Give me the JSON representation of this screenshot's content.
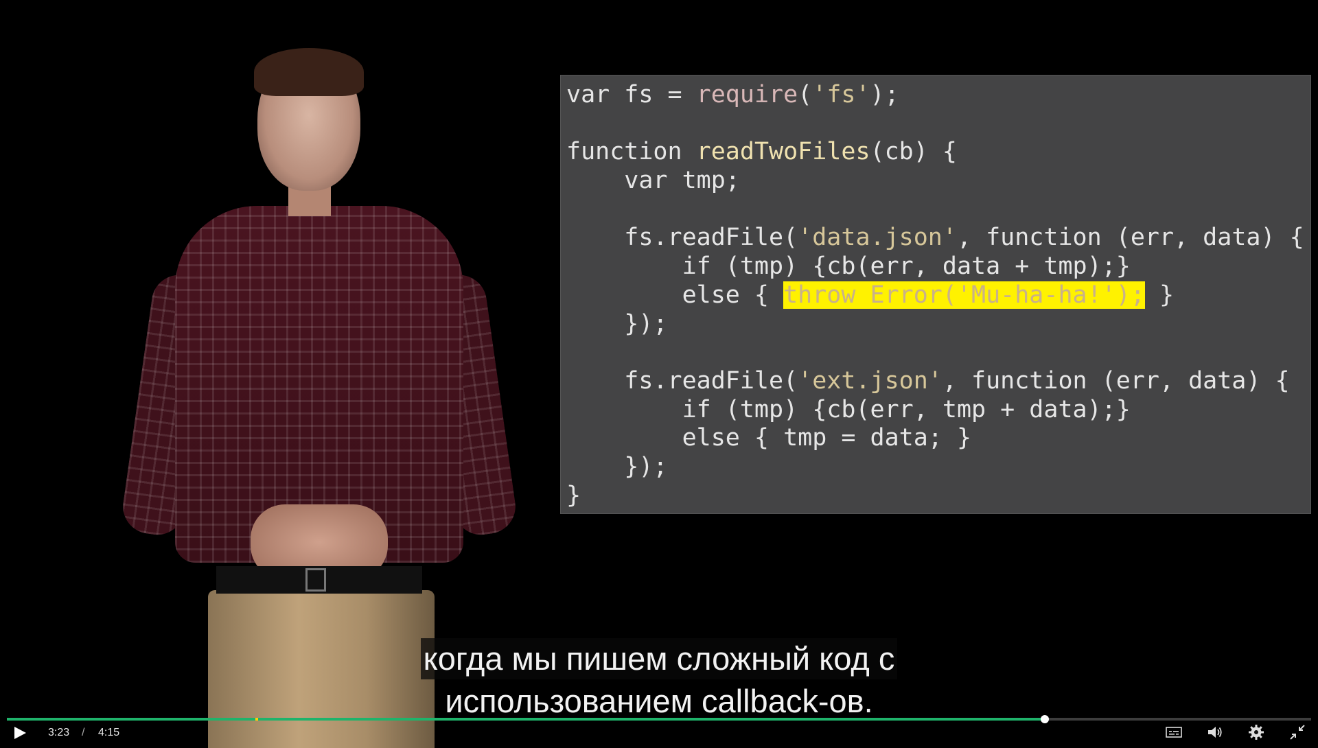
{
  "code": {
    "lines": [
      [
        {
          "t": "var fs = ",
          "c": ""
        },
        {
          "t": "require",
          "c": "req"
        },
        {
          "t": "(",
          "c": ""
        },
        {
          "t": "'fs'",
          "c": "str"
        },
        {
          "t": ");",
          "c": ""
        }
      ],
      [],
      [
        {
          "t": "function ",
          "c": ""
        },
        {
          "t": "readTwoFiles",
          "c": "fn"
        },
        {
          "t": "(cb) {",
          "c": ""
        }
      ],
      [
        {
          "t": "    var tmp;",
          "c": ""
        }
      ],
      [],
      [
        {
          "t": "    fs.readFile(",
          "c": ""
        },
        {
          "t": "'data.json'",
          "c": "str"
        },
        {
          "t": ", function (err, data) {",
          "c": ""
        }
      ],
      [
        {
          "t": "        if (tmp) {cb(err, data + tmp);}",
          "c": ""
        }
      ],
      [
        {
          "t": "        else { ",
          "c": ""
        },
        {
          "t": "throw Error('Mu-ha-ha!');",
          "c": "hl"
        },
        {
          "t": " }",
          "c": ""
        }
      ],
      [
        {
          "t": "    });",
          "c": ""
        }
      ],
      [],
      [
        {
          "t": "    fs.readFile(",
          "c": ""
        },
        {
          "t": "'ext.json'",
          "c": "str"
        },
        {
          "t": ", function (err, data) {",
          "c": ""
        }
      ],
      [
        {
          "t": "        if (tmp) {cb(err, tmp + data);}",
          "c": ""
        }
      ],
      [
        {
          "t": "        else { tmp = data; }",
          "c": ""
        }
      ],
      [
        {
          "t": "    });",
          "c": ""
        }
      ],
      [
        {
          "t": "}",
          "c": ""
        }
      ]
    ]
  },
  "subtitles": {
    "line1": "когда мы пишем сложный код с",
    "line2": "использованием callback-ов."
  },
  "player": {
    "current_time": "3:23",
    "separator": "/",
    "total_time": "4:15",
    "progress": 0.796,
    "accent_color": "#1fb36b",
    "icons": [
      "play-icon",
      "captions-icon",
      "volume-icon",
      "settings-icon",
      "exit-fullscreen-icon"
    ]
  }
}
